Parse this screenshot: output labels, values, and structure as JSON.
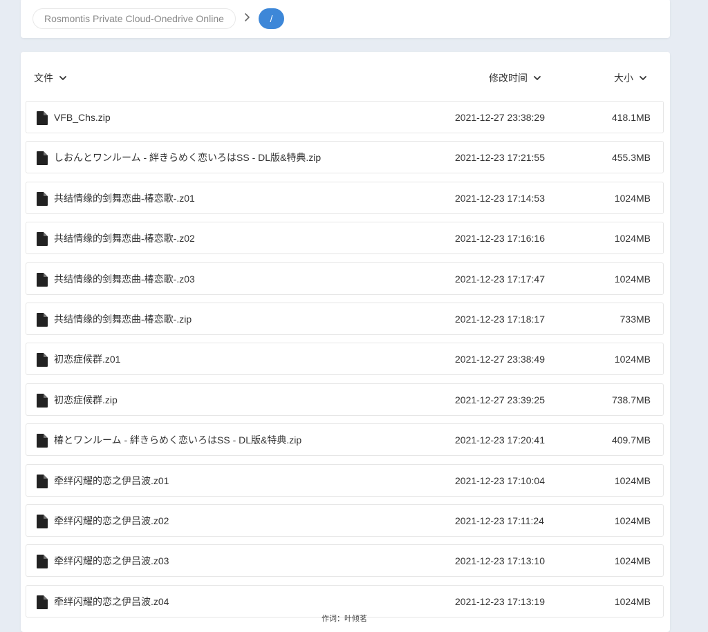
{
  "breadcrumb": {
    "home_label": "Rosmontis Private Cloud-Onedrive Online",
    "separator_icon": "chevron-right-icon",
    "current_label": "/"
  },
  "header": {
    "name_label": "文件",
    "modified_label": "修改时间",
    "size_label": "大小",
    "sort_icon": "chevron-down-icon"
  },
  "files": [
    {
      "name": "VFB_Chs.zip",
      "modified": "2021-12-27 23:38:29",
      "size": "418.1MB"
    },
    {
      "name": "しおんとワンルーム - 絆きらめく恋いろはSS - DL版&特典.zip",
      "modified": "2021-12-23 17:21:55",
      "size": "455.3MB"
    },
    {
      "name": "共结情缘的剑舞恋曲-椿恋歌-.z01",
      "modified": "2021-12-23 17:14:53",
      "size": "1024MB"
    },
    {
      "name": "共结情缘的剑舞恋曲-椿恋歌-.z02",
      "modified": "2021-12-23 17:16:16",
      "size": "1024MB"
    },
    {
      "name": "共结情缘的剑舞恋曲-椿恋歌-.z03",
      "modified": "2021-12-23 17:17:47",
      "size": "1024MB"
    },
    {
      "name": "共结情缘的剑舞恋曲-椿恋歌-.zip",
      "modified": "2021-12-23 17:18:17",
      "size": "733MB"
    },
    {
      "name": "初恋症候群.z01",
      "modified": "2021-12-27 23:38:49",
      "size": "1024MB"
    },
    {
      "name": "初恋症候群.zip",
      "modified": "2021-12-27 23:39:25",
      "size": "738.7MB"
    },
    {
      "name": "椿とワンルーム - 絆きらめく恋いろはSS - DL版&特典.zip",
      "modified": "2021-12-23 17:20:41",
      "size": "409.7MB"
    },
    {
      "name": "牵绊闪耀的恋之伊吕波.z01",
      "modified": "2021-12-23 17:10:04",
      "size": "1024MB"
    },
    {
      "name": "牵绊闪耀的恋之伊吕波.z02",
      "modified": "2021-12-23 17:11:24",
      "size": "1024MB"
    },
    {
      "name": "牵绊闪耀的恋之伊吕波.z03",
      "modified": "2021-12-23 17:13:10",
      "size": "1024MB"
    },
    {
      "name": "牵绊闪耀的恋之伊吕波.z04",
      "modified": "2021-12-23 17:13:19",
      "size": "1024MB"
    }
  ],
  "file_icon": "file-icon",
  "lyric_overlay": "作词：叶倾茗",
  "colors": {
    "page_background": "#e7ecf3",
    "accent": "#3d87d8",
    "row_border": "#e6e6e6"
  }
}
